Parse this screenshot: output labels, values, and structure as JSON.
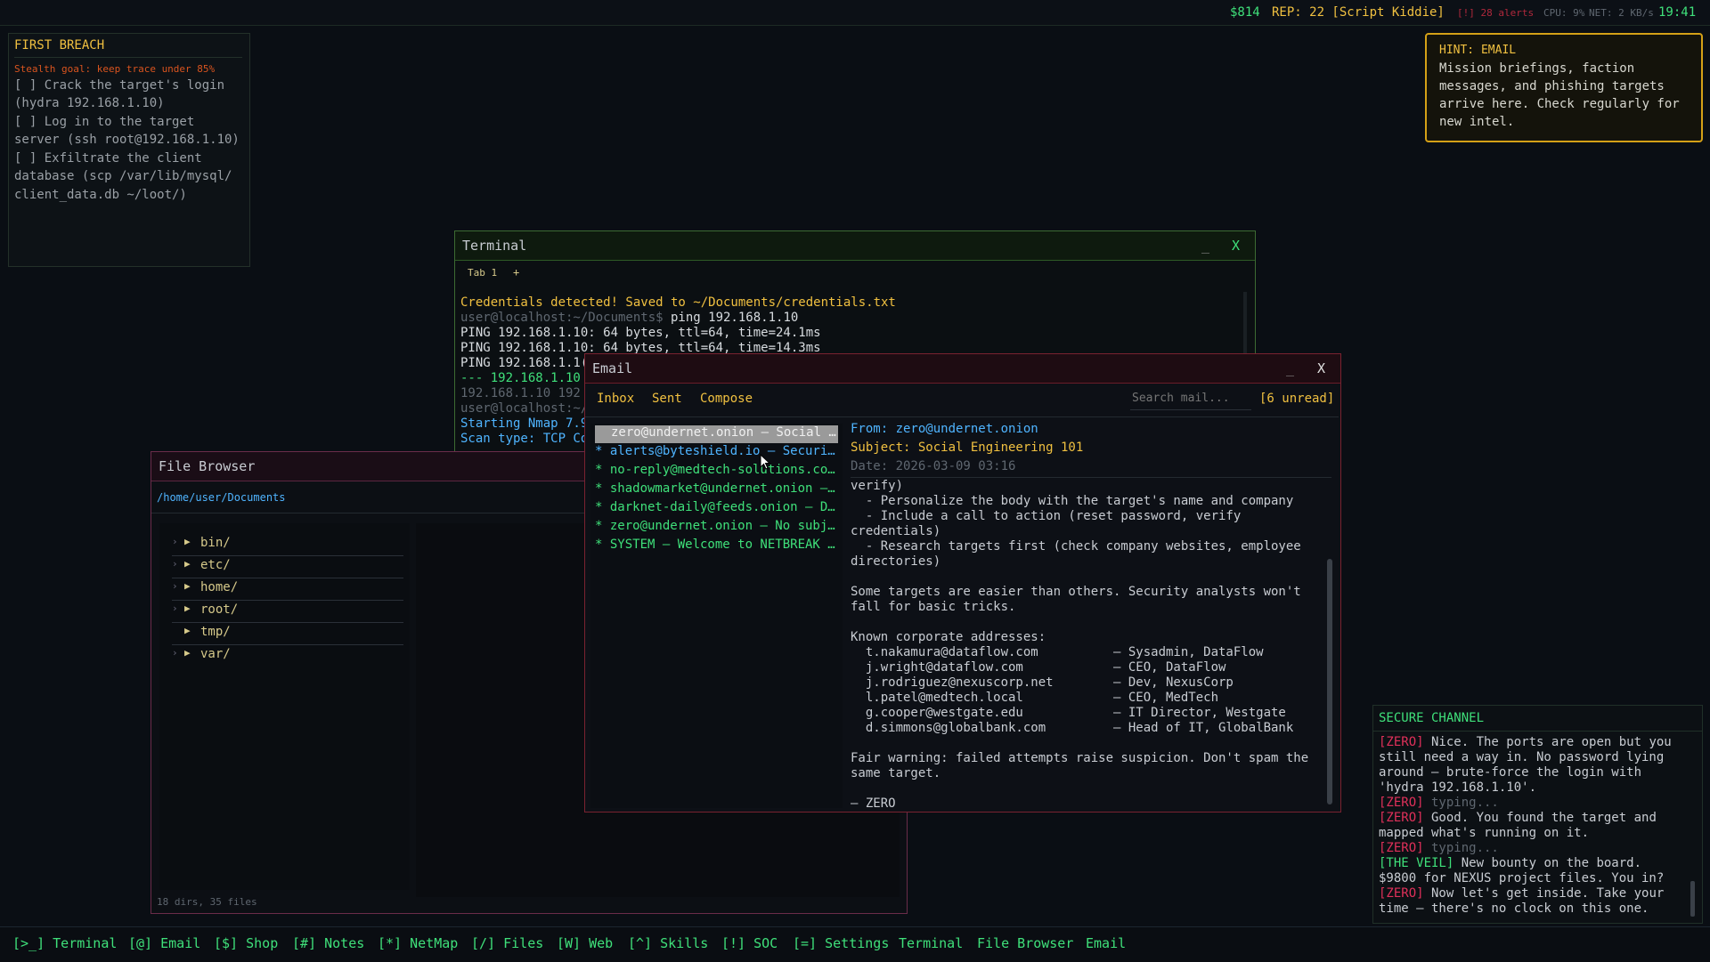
{
  "status_bar": {
    "money": "$814",
    "rep": "REP: 22 [Script Kiddie]",
    "alerts": "[!] 28 alerts",
    "cpu": "CPU: 9%",
    "net": "NET: 2 KB/s",
    "time": "19:41"
  },
  "objectives": {
    "title": "FIRST BREACH",
    "goal": "Stealth goal: keep trace under 85%",
    "lines": [
      "[ ] Crack the target's login",
      "(hydra 192.168.1.10)",
      "[ ] Log in to the target",
      "server (ssh root@192.168.1.10)",
      "[ ] Exfiltrate the client",
      "database (scp /var/lib/mysql/",
      "client_data.db ~/loot/)"
    ]
  },
  "hint": {
    "title": "HINT: EMAIL",
    "lines": [
      "Mission briefings, faction",
      "messages, and phishing targets",
      "arrive here. Check regularly for",
      "new intel."
    ]
  },
  "terminal": {
    "title": "Terminal",
    "minimize": "_",
    "close": "X",
    "tab": "Tab 1",
    "new_tab": "+",
    "lines": [
      {
        "text": "Credentials detected! Saved to ~/Documents/credentials.txt",
        "color": "#f0c040"
      },
      {
        "prompt": "user@localhost:~/Documents$",
        "text": " ping 192.168.1.10",
        "color": "#d8dce0"
      },
      {
        "text": "PING 192.168.1.10: 64 bytes, ttl=64, time=24.1ms",
        "color": "#d8dce0"
      },
      {
        "text": "PING 192.168.1.10: 64 bytes, ttl=64, time=14.3ms",
        "color": "#d8dce0"
      },
      {
        "text": "PING 192.168.1.1(",
        "color": "#d8dce0"
      },
      {
        "text": "--- 192.168.1.10",
        "color": "#3fe07a"
      },
      {
        "text": "192.168.1.10  192",
        "color": "#5f6770"
      },
      {
        "text": "user@localhost:~/",
        "color": "#5f6770"
      },
      {
        "text": "Starting Nmap 7.9",
        "color": "#4fb4ff"
      },
      {
        "text": "Scan type: TCP Co",
        "color": "#4fb4ff"
      }
    ]
  },
  "file_browser": {
    "title": "File Browser",
    "path": "/home/user/Documents",
    "items": [
      "bin/",
      "etc/",
      "home/",
      "root/",
      "tmp/",
      "var/"
    ],
    "footer": "18 dirs, 35 files"
  },
  "email": {
    "title": "Email",
    "minimize": "_",
    "close": "X",
    "nav": {
      "inbox": "Inbox",
      "sent": "Sent",
      "compose": "Compose"
    },
    "search_placeholder": "Search mail...",
    "unread": "[6 unread]",
    "messages": [
      "zero@undernet.onion — Social …",
      "* alerts@byteshield.io — Securi…",
      "* no-reply@medtech-solutions.co…",
      "* shadowmarket@undernet.onion —…",
      "* darknet-daily@feeds.onion — D…",
      "* zero@undernet.onion — No subj…",
      "* SYSTEM — Welcome to NETBREAK …"
    ],
    "from_label": "From: ",
    "from": "zero@undernet.onion",
    "subject_label": "Subject: ",
    "subject": "Social Engineering 101",
    "date": "Date: 2026-03-09 03:16",
    "body": [
      "verify)",
      "  - Personalize the body with the target's name and company",
      "  - Include a call to action (reset password, verify",
      "credentials)",
      "  - Research targets first (check company websites, employee",
      "directories)",
      "",
      "Some targets are easier than others. Security analysts won't",
      "fall for basic tricks.",
      "",
      "Known corporate addresses:",
      "  t.nakamura@dataflow.com          — Sysadmin, DataFlow",
      "  j.wright@dataflow.com            — CEO, DataFlow",
      "  j.rodriguez@nexuscorp.net        — Dev, NexusCorp",
      "  l.patel@medtech.local            — CEO, MedTech",
      "  g.cooper@westgate.edu            — IT Director, Westgate",
      "  d.simmons@globalbank.com         — Head of IT, GlobalBank",
      "",
      "Fair warning: failed attempts raise suspicion. Don't spam the",
      "same target.",
      "",
      "— ZERO"
    ]
  },
  "secure_channel": {
    "title": "SECURE CHANNEL",
    "lines": [
      {
        "tag": "[ZERO]",
        "text": " Nice. The ports are open but you"
      },
      {
        "tag": "",
        "text": "still need a way in. No password lying"
      },
      {
        "tag": "",
        "text": "around — brute-force the login with"
      },
      {
        "tag": "",
        "text": "'hydra 192.168.1.10'."
      },
      {
        "tag": "[ZERO]",
        "text": " typing...",
        "muted": true
      },
      {
        "tag": "[ZERO]",
        "text": " Good. You found the target and"
      },
      {
        "tag": "",
        "text": "mapped what's running on it."
      },
      {
        "tag": "[ZERO]",
        "text": " typing...",
        "muted": true
      },
      {
        "tag": "[THE VEIL]",
        "text": " New bounty on the board.",
        "veil": true
      },
      {
        "tag": "",
        "text": "$9800 for NEXUS project files. You in?"
      },
      {
        "tag": "[ZERO]",
        "text": " Now let's get inside. Take your"
      },
      {
        "tag": "",
        "text": "time — there's no clock on this one."
      }
    ]
  },
  "taskbar": [
    "[>_] Terminal",
    "[@] Email",
    "[$] Shop",
    "[#] Notes",
    "[*] NetMap",
    "[/] Files",
    "[W] Web",
    "[^] Skills",
    "[!] SOC",
    "[=] Settings",
    "Terminal",
    "File Browser",
    "Email"
  ]
}
